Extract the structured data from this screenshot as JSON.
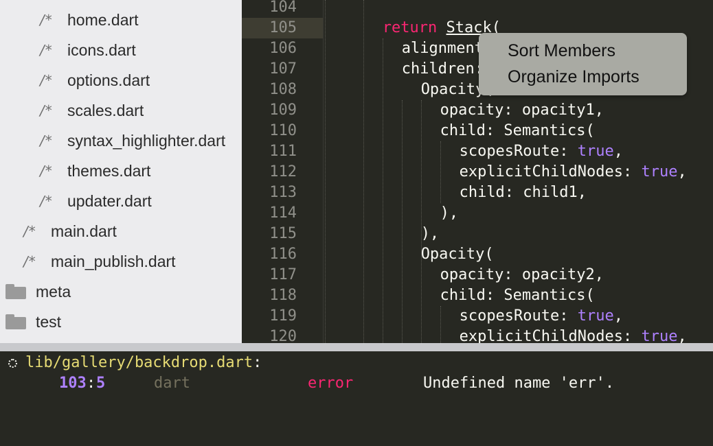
{
  "sidebar": {
    "items": [
      {
        "name": "home.dart",
        "type": "file",
        "indent": 2
      },
      {
        "name": "icons.dart",
        "type": "file",
        "indent": 2
      },
      {
        "name": "options.dart",
        "type": "file",
        "indent": 2
      },
      {
        "name": "scales.dart",
        "type": "file",
        "indent": 2
      },
      {
        "name": "syntax_highlighter.dart",
        "type": "file",
        "indent": 2
      },
      {
        "name": "themes.dart",
        "type": "file",
        "indent": 2
      },
      {
        "name": "updater.dart",
        "type": "file",
        "indent": 2
      },
      {
        "name": "main.dart",
        "type": "file",
        "indent": 1
      },
      {
        "name": "main_publish.dart",
        "type": "file",
        "indent": 1
      },
      {
        "name": "meta",
        "type": "folder",
        "indent": 0
      },
      {
        "name": "test",
        "type": "folder",
        "indent": 0
      }
    ],
    "file_icon_glyph": "/*"
  },
  "editor": {
    "current_line": "105",
    "lines": [
      {
        "num": "104",
        "indent": 0,
        "tokens": []
      },
      {
        "num": "105",
        "indent": 3,
        "tokens": [
          {
            "t": "return",
            "c": "kw"
          },
          {
            "t": " "
          },
          {
            "t": "Stack",
            "c": "ul"
          },
          {
            "t": "("
          }
        ]
      },
      {
        "num": "106",
        "indent": 4,
        "tokens": [
          {
            "t": "alignment: "
          }
        ]
      },
      {
        "num": "107",
        "indent": 4,
        "tokens": [
          {
            "t": "children: "
          }
        ]
      },
      {
        "num": "108",
        "indent": 5,
        "tokens": [
          {
            "t": "Opacity("
          }
        ]
      },
      {
        "num": "109",
        "indent": 6,
        "tokens": [
          {
            "t": "opacity: opacity1,"
          }
        ]
      },
      {
        "num": "110",
        "indent": 6,
        "tokens": [
          {
            "t": "child: Semantics("
          }
        ]
      },
      {
        "num": "111",
        "indent": 7,
        "tokens": [
          {
            "t": "scopesRoute: "
          },
          {
            "t": "true",
            "c": "bool"
          },
          {
            "t": ","
          }
        ]
      },
      {
        "num": "112",
        "indent": 7,
        "tokens": [
          {
            "t": "explicitChildNodes: "
          },
          {
            "t": "true",
            "c": "bool"
          },
          {
            "t": ","
          }
        ]
      },
      {
        "num": "113",
        "indent": 7,
        "tokens": [
          {
            "t": "child: child1,"
          }
        ]
      },
      {
        "num": "114",
        "indent": 6,
        "tokens": [
          {
            "t": "),"
          }
        ]
      },
      {
        "num": "115",
        "indent": 5,
        "tokens": [
          {
            "t": "),"
          }
        ]
      },
      {
        "num": "116",
        "indent": 5,
        "tokens": [
          {
            "t": "Opacity("
          }
        ]
      },
      {
        "num": "117",
        "indent": 6,
        "tokens": [
          {
            "t": "opacity: opacity2,"
          }
        ]
      },
      {
        "num": "118",
        "indent": 6,
        "tokens": [
          {
            "t": "child: Semantics("
          }
        ]
      },
      {
        "num": "119",
        "indent": 7,
        "tokens": [
          {
            "t": "scopesRoute: "
          },
          {
            "t": "true",
            "c": "bool"
          },
          {
            "t": ","
          }
        ]
      },
      {
        "num": "120",
        "indent": 7,
        "tokens": [
          {
            "t": "explicitChildNodes: "
          },
          {
            "t": "true",
            "c": "bool"
          },
          {
            "t": ","
          }
        ]
      }
    ]
  },
  "context_menu": {
    "items": [
      "Sort Members",
      "Organize Imports"
    ]
  },
  "output": {
    "file": "lib/gallery/backdrop.dart",
    "colon": ":",
    "line": "103",
    "sep": ":",
    "col": "5",
    "source": "dart",
    "severity": "error",
    "message": "Undefined name 'err'."
  },
  "colors": {
    "keyword": "#f92672",
    "boolean": "#ae81ff",
    "path": "#e6db74",
    "location": "#ae81ff",
    "source": "#75715e",
    "error": "#f92672",
    "sidebar_bg": "#ececee",
    "editor_bg": "#272822"
  }
}
